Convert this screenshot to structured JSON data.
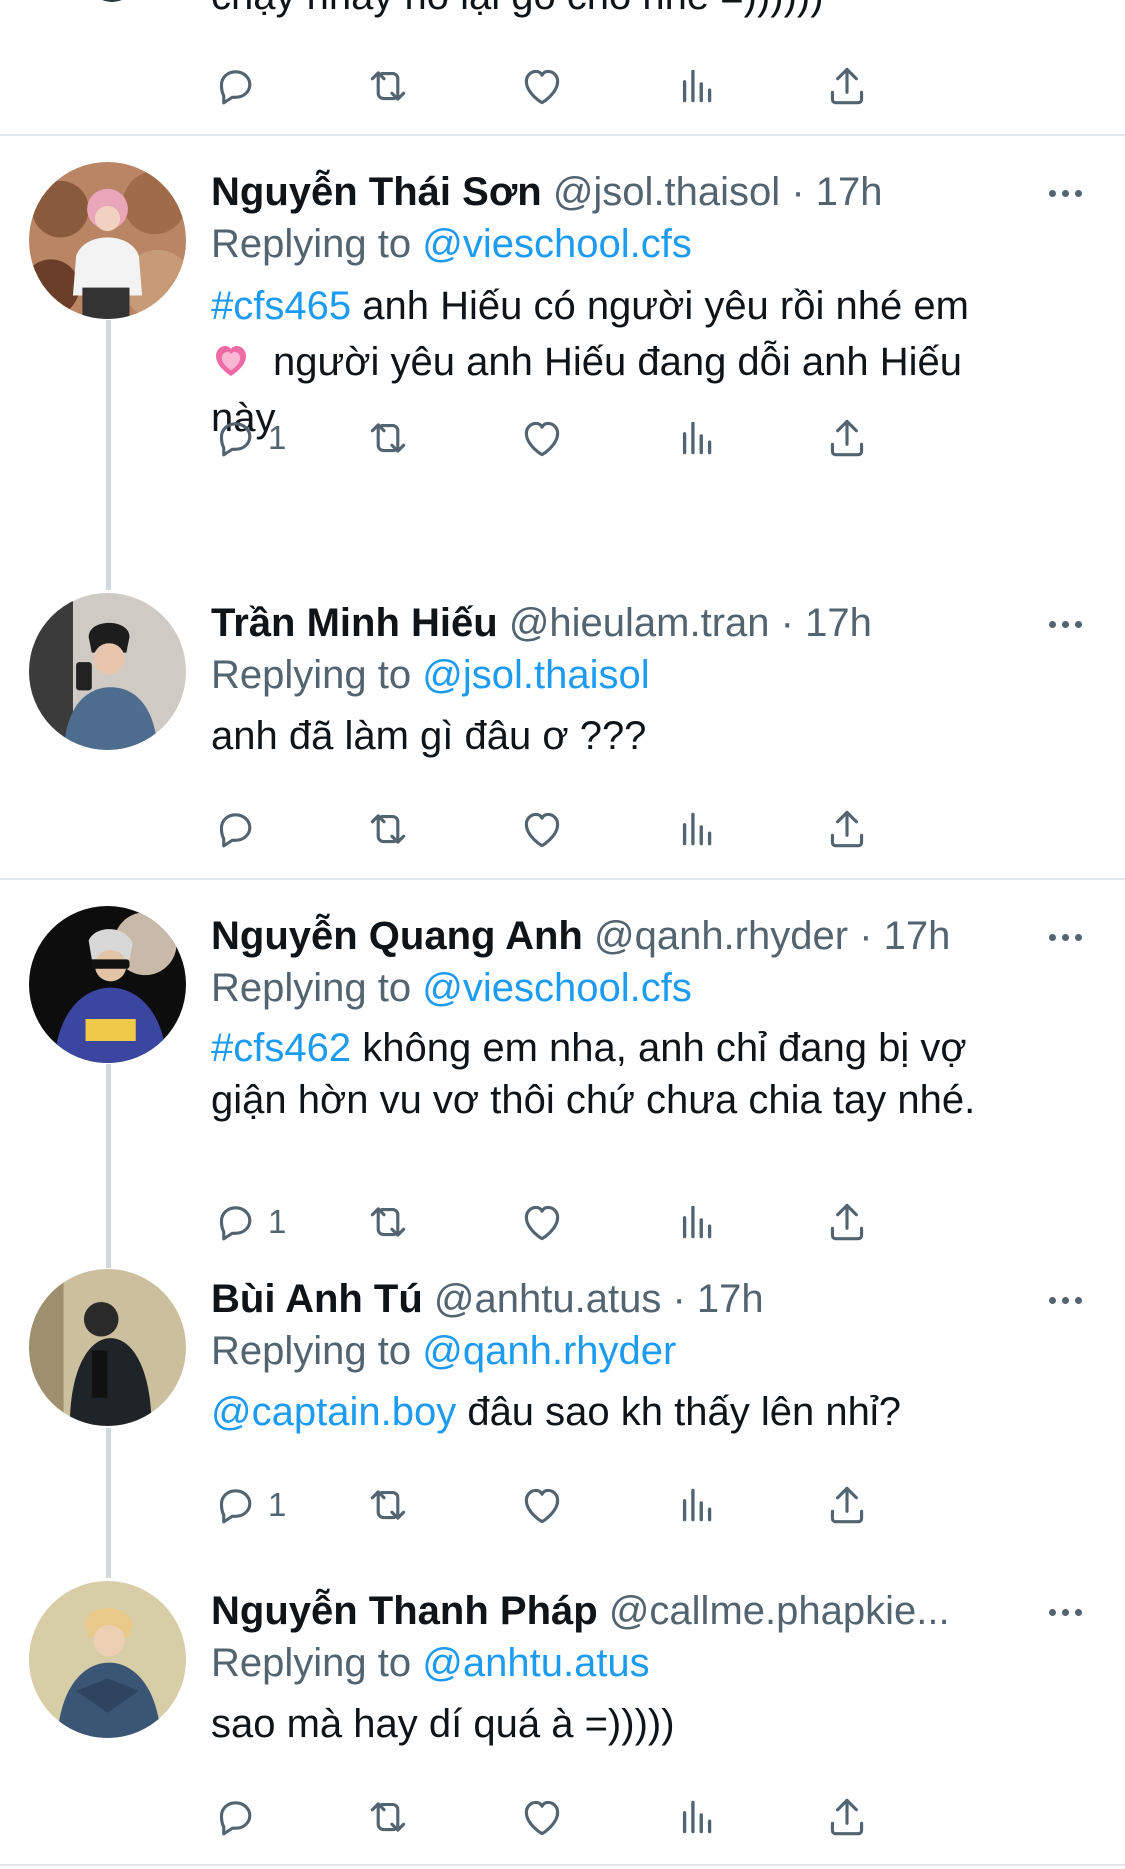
{
  "top_partial": {
    "text": "chạy nhảy nó lại gõ cho nhé =))))))"
  },
  "tweets": [
    {
      "name": "Nguyễn Thái Sơn",
      "handle": "@jsol.thaisol",
      "time": "17h",
      "replying_prefix": "Replying to",
      "replying_to": "@vieschool.cfs",
      "hashtag": "#cfs465",
      "line1": " anh Hiếu có người yêu rồi nhé em",
      "line2": "người yêu anh Hiếu đang dỗi anh Hiếu",
      "line3": "này",
      "reply_count": "1"
    },
    {
      "name": "Trần Minh Hiếu",
      "handle": "@hieulam.tran",
      "time": "17h",
      "replying_prefix": "Replying to",
      "replying_to": "@jsol.thaisol",
      "text": "anh đã làm gì đâu ơ ???",
      "reply_count": ""
    },
    {
      "name": "Nguyễn Quang Anh",
      "handle": "@qanh.rhyder",
      "time": "17h",
      "replying_prefix": "Replying to",
      "replying_to": "@vieschool.cfs",
      "hashtag": "#cfs462",
      "line1": " không em nha, anh chỉ đang bị vợ",
      "line2": "giận hờn vu vơ thôi chứ chưa chia tay nhé.",
      "reply_count": "1"
    },
    {
      "name": "Bùi Anh Tú",
      "handle": "@anhtu.atus",
      "time": "17h",
      "replying_prefix": "Replying to",
      "replying_to": "@qanh.rhyder",
      "mention": "@captain.boy",
      "text": " đâu sao kh thấy lên nhỉ?",
      "reply_count": "1"
    },
    {
      "name": "Nguyễn Thanh Pháp",
      "handle": "@callme.phapkie...",
      "time": "",
      "replying_prefix": "Replying to",
      "replying_to": "@anhtu.atus",
      "text": "sao mà hay dí quá à =)))))",
      "reply_count": ""
    }
  ],
  "icons": {
    "reply": "reply-icon",
    "retweet": "retweet-icon",
    "like": "heart-icon",
    "analytics": "analytics-icon",
    "share": "share-icon",
    "more": "more-icon",
    "emoji": "pink-heart-emoji"
  },
  "colors": {
    "link": "#1d9bf0",
    "secondary_text": "#536471",
    "primary_text": "#0f1419",
    "thread_line": "#cfd9de",
    "divider": "#e1e8ed"
  }
}
